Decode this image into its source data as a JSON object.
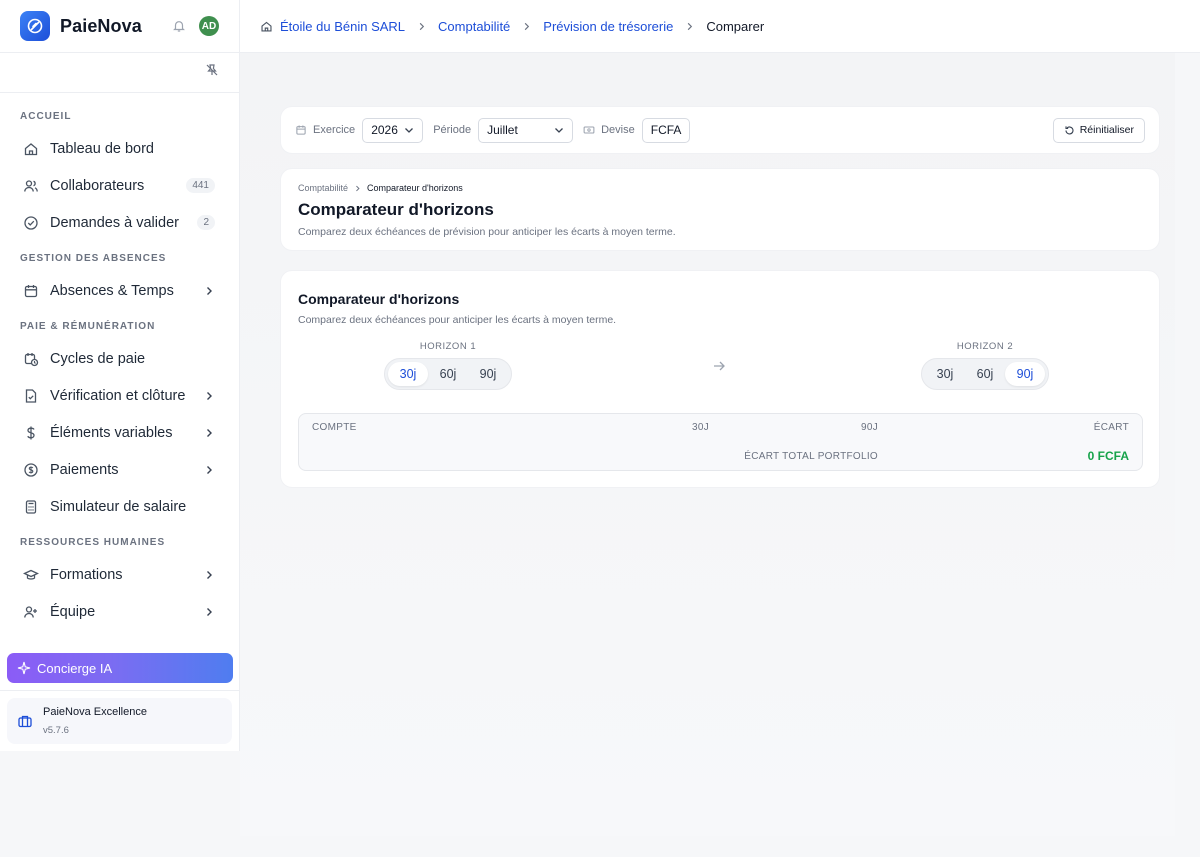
{
  "app": {
    "name": "PaieNova",
    "avatar_initials": "AD"
  },
  "breadcrumb": [
    "Étoile du Bénin SARL",
    "Comptabilité",
    "Prévision de trésorerie",
    "Comparer"
  ],
  "sidebar": {
    "sections": [
      {
        "title": "ACCUEIL",
        "items": [
          {
            "label": "Tableau de bord",
            "icon": "home-icon"
          },
          {
            "label": "Collaborateurs",
            "icon": "users-icon",
            "badge": "441"
          },
          {
            "label": "Demandes à valider",
            "icon": "check-circle-icon",
            "badge": "2"
          }
        ]
      },
      {
        "title": "GESTION DES ABSENCES",
        "items": [
          {
            "label": "Absences & Temps",
            "icon": "calendar-icon",
            "chevron": true
          }
        ]
      },
      {
        "title": "PAIE & RÉMUNÉRATION",
        "items": [
          {
            "label": "Cycles de paie",
            "icon": "calendar-clock-icon"
          },
          {
            "label": "Vérification et clôture",
            "icon": "file-check-icon",
            "chevron": true
          },
          {
            "label": "Éléments variables",
            "icon": "dollar-icon",
            "chevron": true
          },
          {
            "label": "Paiements",
            "icon": "coin-icon",
            "chevron": true
          },
          {
            "label": "Simulateur de salaire",
            "icon": "calculator-icon"
          }
        ]
      },
      {
        "title": "RESSOURCES HUMAINES",
        "items": [
          {
            "label": "Formations",
            "icon": "graduation-cap-icon",
            "chevron": true
          },
          {
            "label": "Équipe",
            "icon": "user-plus-icon",
            "chevron": true
          }
        ]
      }
    ],
    "concierge_label": "Concierge IA",
    "footer": {
      "name": "PaieNova Excellence",
      "version": "v5.7.6"
    }
  },
  "filters": {
    "exercice_label": "Exercice",
    "exercice_value": "2026",
    "periode_label": "Période",
    "periode_value": "Juillet",
    "devise_label": "Devise",
    "devise_value": "FCFA",
    "reset_label": "Réinitialiser"
  },
  "header": {
    "crumb_parent": "Comptabilité",
    "crumb_current": "Comparateur d'horizons",
    "title": "Comparateur d'horizons",
    "subtitle": "Comparez deux échéances de prévision pour anticiper les écarts à moyen terme."
  },
  "comparator": {
    "title": "Comparateur d'horizons",
    "subtitle": "Comparez deux échéances pour anticiper les écarts à moyen terme.",
    "horizon1": {
      "label": "HORIZON 1",
      "options": [
        "30j",
        "60j",
        "90j"
      ],
      "selected": "30j"
    },
    "horizon2": {
      "label": "HORIZON 2",
      "options": [
        "30j",
        "60j",
        "90j"
      ],
      "selected": "90j"
    },
    "table": {
      "columns": [
        "COMPTE",
        "30J",
        "90J",
        "ÉCART"
      ],
      "total_label": "ÉCART TOTAL PORTFOLIO",
      "total_value": "0 FCFA"
    }
  },
  "colors": {
    "accent": "#1d4ed8",
    "positive": "#16a34a",
    "avatar": "#3f8f4e"
  }
}
